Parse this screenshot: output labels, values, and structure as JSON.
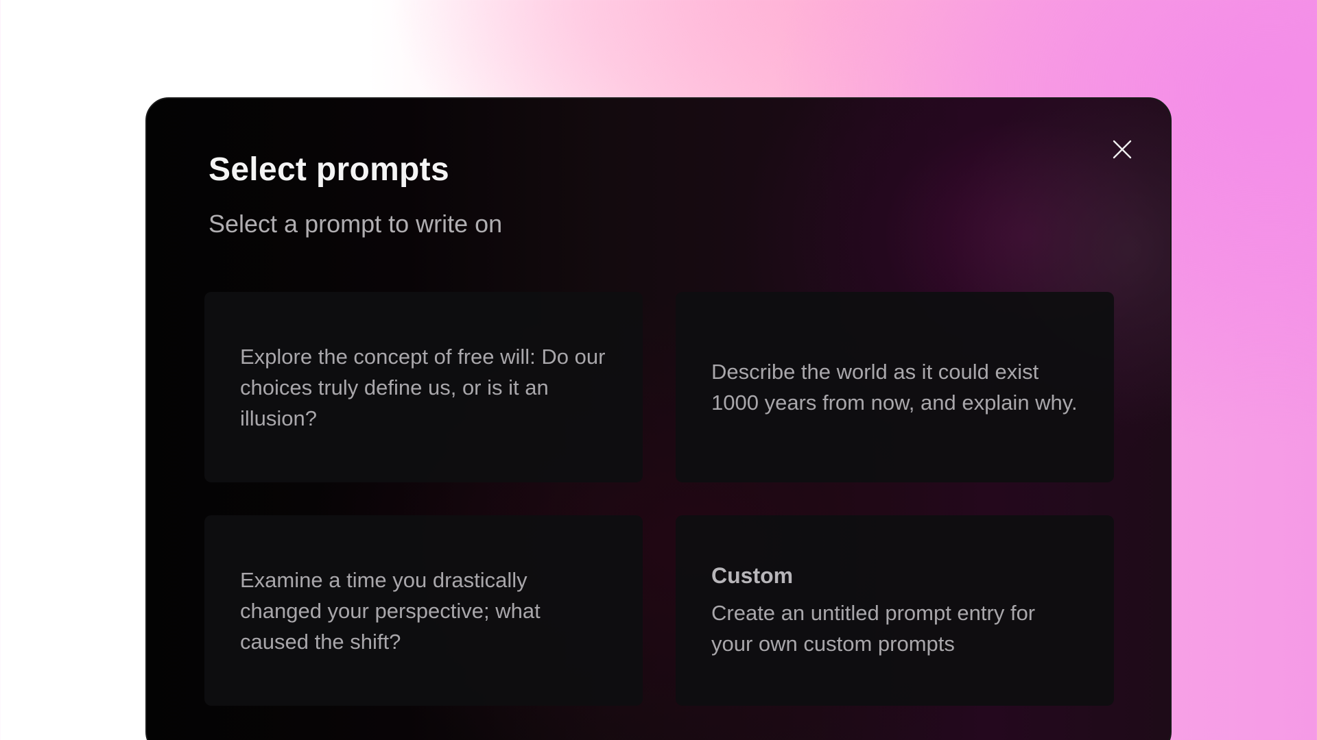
{
  "modal": {
    "title": "Select prompts",
    "subtitle": "Select a prompt to write on",
    "close_icon": "close-icon"
  },
  "prompts": [
    {
      "text": "Explore the concept of free will: Do our choices truly define us, or is it an illusion?"
    },
    {
      "text": "Describe the world as it could exist 1000 years from now, and explain why."
    },
    {
      "text": "Examine a time you drastically changed your perspective; what caused the shift?"
    },
    {
      "title": "Custom",
      "text": "Create an untitled prompt entry for your own custom prompts"
    }
  ],
  "colors": {
    "modal_background": "#0a0708",
    "card_background": "#0e0e10",
    "title_text": "#f4f4f4",
    "body_text": "#a9a7ab",
    "accent_pink": "#f48de8"
  }
}
